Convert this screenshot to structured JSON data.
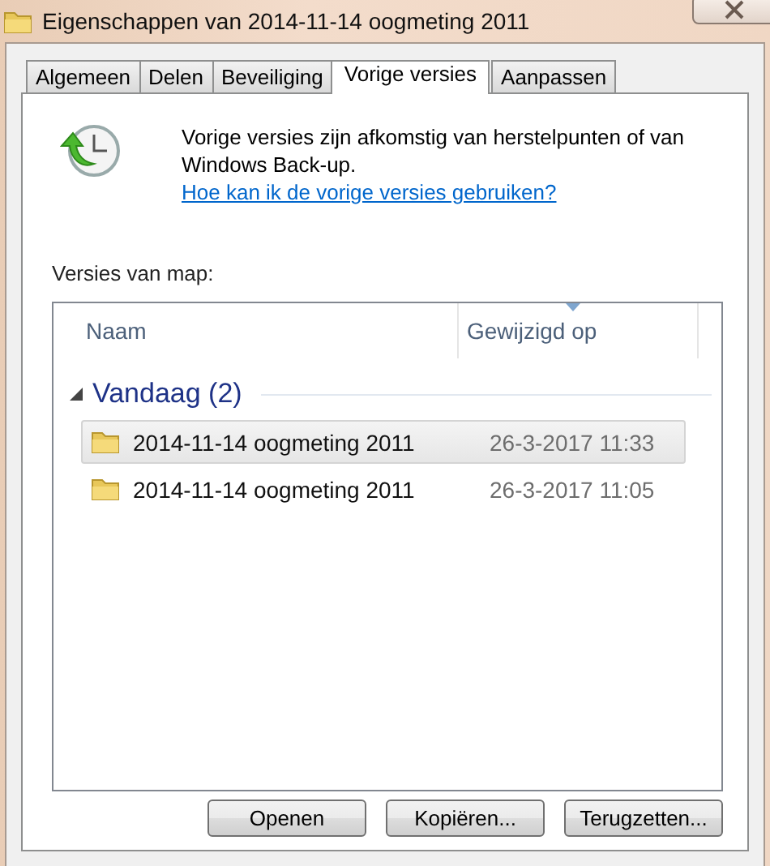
{
  "window": {
    "title": "Eigenschappen van 2014-11-14 oogmeting 2011"
  },
  "tabs": [
    {
      "label": "Algemeen",
      "selected": false
    },
    {
      "label": "Delen",
      "selected": false
    },
    {
      "label": "Beveiliging",
      "selected": false
    },
    {
      "label": "Vorige versies",
      "selected": true
    },
    {
      "label": "Aanpassen",
      "selected": false
    }
  ],
  "info": {
    "text": "Vorige versies zijn afkomstig van herstelpunten of van Windows Back-up.",
    "link": "Hoe kan ik de vorige versies gebruiken?"
  },
  "versions_label": "Versies van map:",
  "table": {
    "columns": [
      "Naam",
      "Gewijzigd op"
    ],
    "groups": [
      {
        "label": "Vandaag (2)",
        "expanded": true,
        "rows": [
          {
            "name": "2014-11-14 oogmeting 2011",
            "modified": "26-3-2017 11:33",
            "selected": true
          },
          {
            "name": "2014-11-14 oogmeting 2011",
            "modified": "26-3-2017 11:05",
            "selected": false
          }
        ]
      }
    ]
  },
  "buttons": [
    "Openen",
    "Kopiëren...",
    "Terugzetten..."
  ]
}
